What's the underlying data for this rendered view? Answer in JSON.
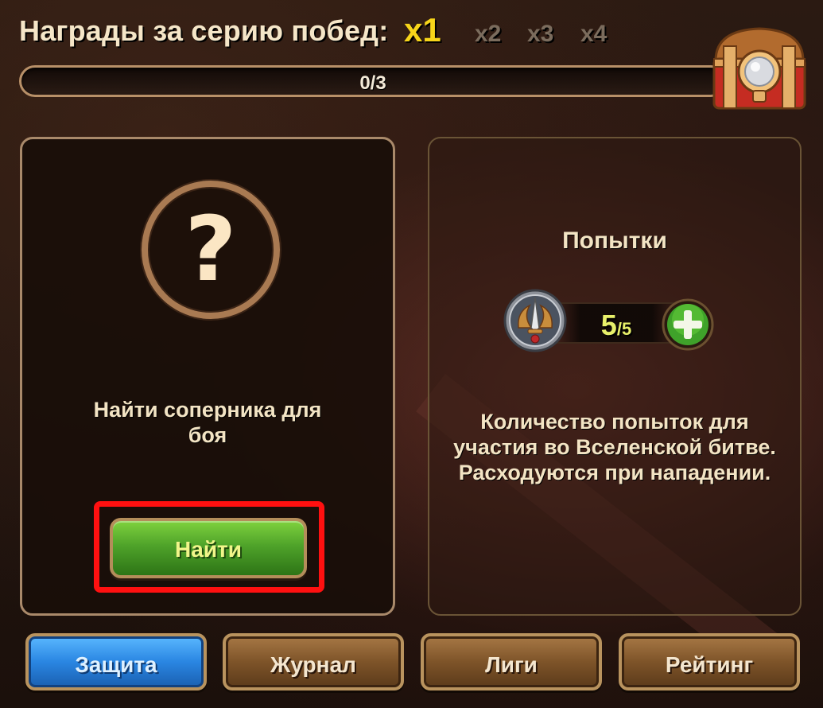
{
  "header": {
    "title": "Награды за серию побед:",
    "multipliers": [
      {
        "label": "x1",
        "active": true
      },
      {
        "label": "x2",
        "active": false
      },
      {
        "label": "x3",
        "active": false
      },
      {
        "label": "x4",
        "active": false
      }
    ],
    "progress": {
      "text": "0/3",
      "value": 0,
      "max": 3
    },
    "chest_icon": "treasure-chest-icon"
  },
  "left_panel": {
    "icon": "question-icon",
    "question_glyph": "?",
    "text": "Найти соперника для боя",
    "button_label": "Найти"
  },
  "right_panel": {
    "title": "Попытки",
    "attempts_current": "5",
    "attempts_sep": "/5",
    "attempts_icon": "sword-emblem-icon",
    "add_icon": "plus-icon",
    "description": "Количество попыток для участия во Вселенской битве. Расходуются при нападении."
  },
  "tabs": [
    {
      "label": "Защита",
      "active": true
    },
    {
      "label": "Журнал",
      "active": false
    },
    {
      "label": "Лиги",
      "active": false
    },
    {
      "label": "Рейтинг",
      "active": false
    }
  ],
  "colors": {
    "highlight": "#ff1010",
    "accent_yellow": "#f7d51a",
    "button_green": "#4fa32a",
    "tab_blue": "#2a86e2",
    "tab_brown": "#7e5429"
  }
}
